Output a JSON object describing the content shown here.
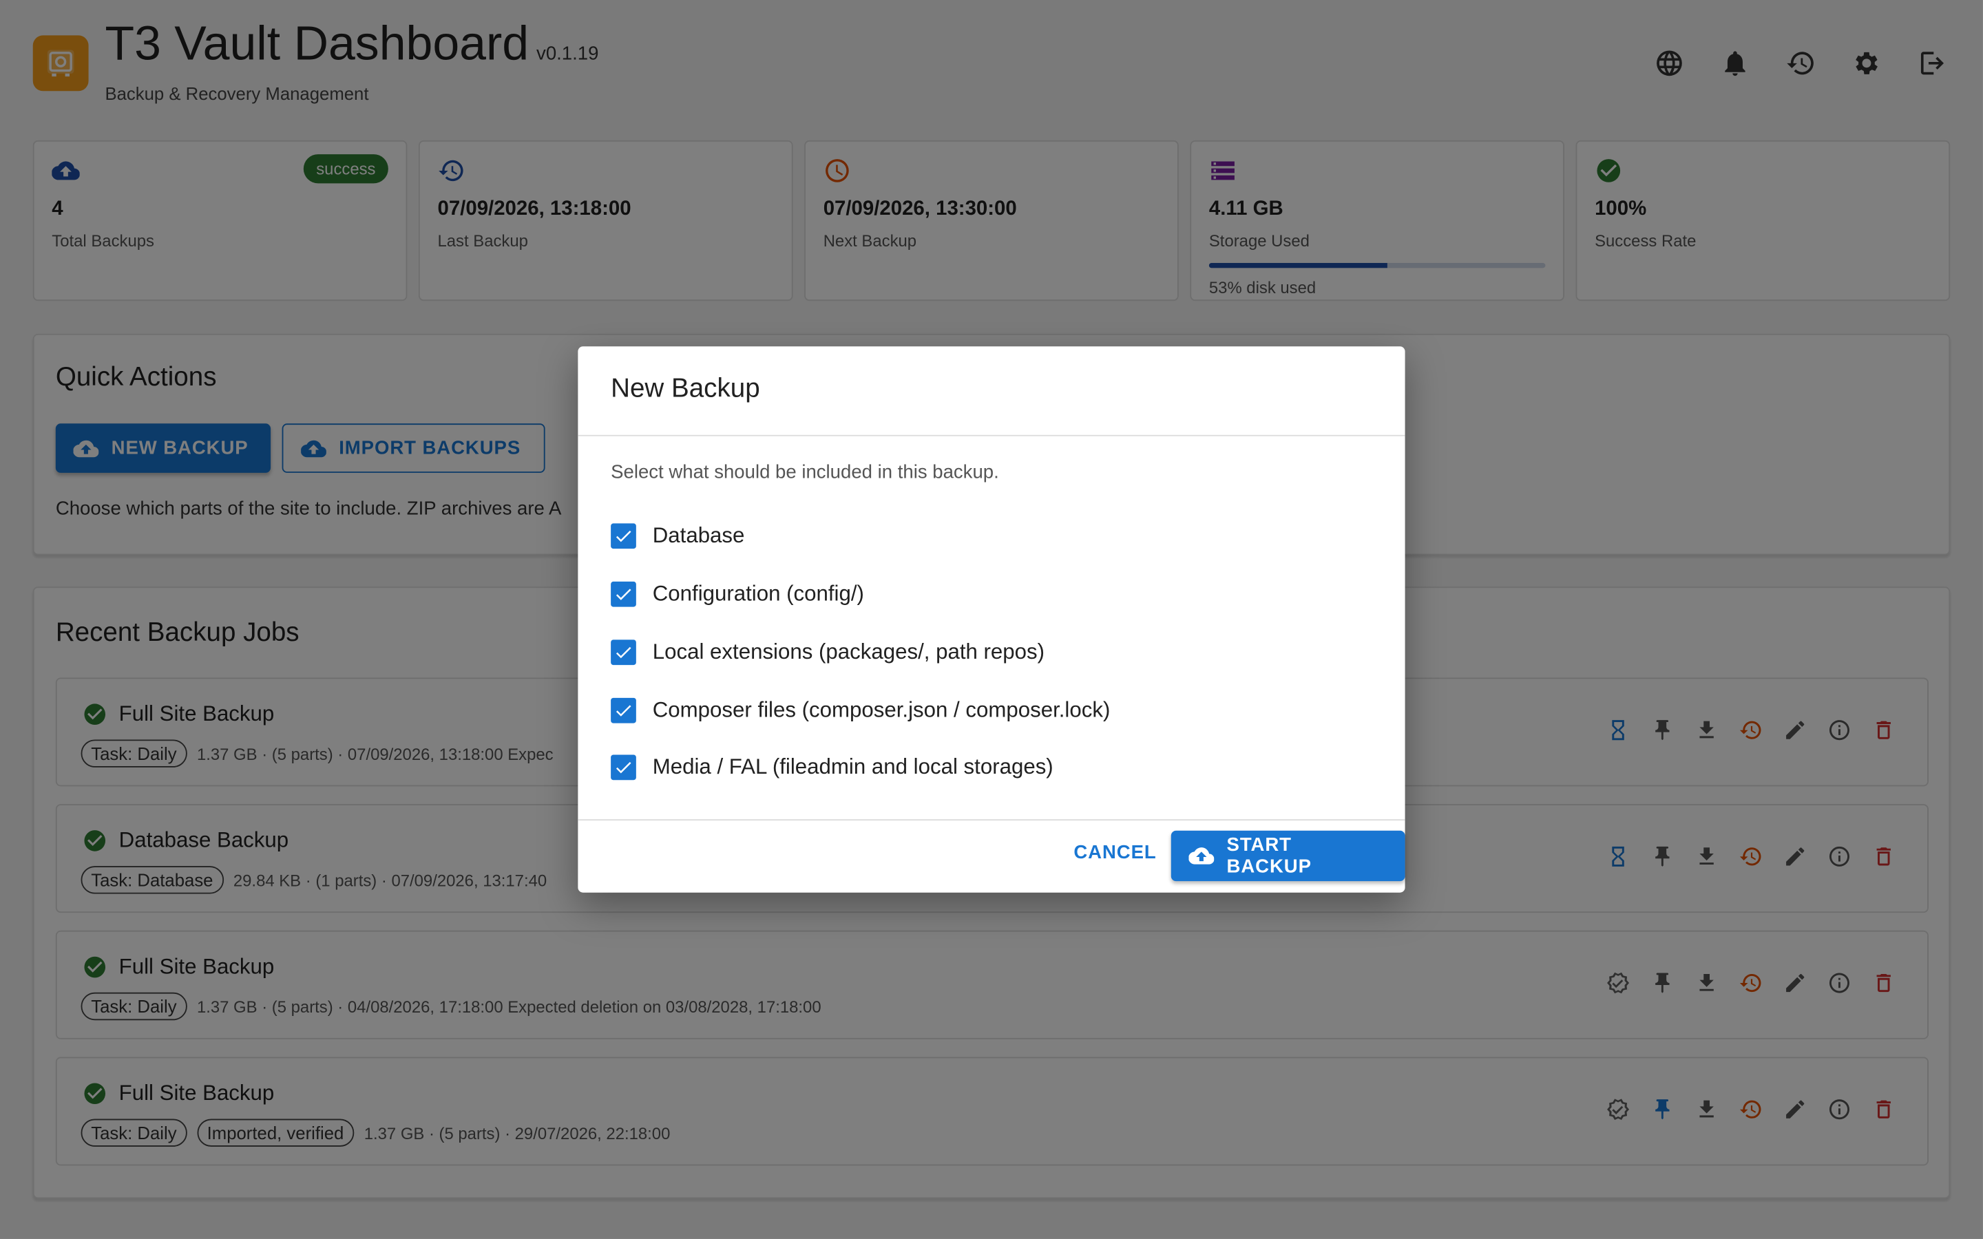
{
  "header": {
    "title": "T3 Vault Dashboard",
    "version": "v0.1.19",
    "subtitle": "Backup & Recovery Management",
    "icons": [
      "globe-icon",
      "bell-icon",
      "history-icon",
      "gear-icon",
      "logout-icon"
    ]
  },
  "stats": [
    {
      "value": "4",
      "label": "Total Backups",
      "badge": "success",
      "icon": "cloud-upload-icon",
      "color": "#1e4fa8"
    },
    {
      "value": "07/09/2026, 13:18:00",
      "label": "Last Backup",
      "icon": "history-icon",
      "color": "#1e4fa8"
    },
    {
      "value": "07/09/2026, 13:30:00",
      "label": "Next Backup",
      "icon": "clock-icon",
      "color": "#e65100"
    },
    {
      "value": "4.11 GB",
      "label": "Storage Used",
      "progress": 53,
      "sub": "53% disk used",
      "icon": "storage-icon",
      "color": "#7b1fa2"
    },
    {
      "value": "100%",
      "label": "Success Rate",
      "icon": "check-circle-icon",
      "color": "#2e7d32"
    }
  ],
  "quick_actions": {
    "title": "Quick Actions",
    "new_backup": "NEW BACKUP",
    "import_backups": "IMPORT BACKUPS",
    "text": "Choose which parts of the site to include. ZIP archives are A"
  },
  "recent_jobs": {
    "title": "Recent Backup Jobs",
    "items": [
      {
        "title": "Full Site Backup",
        "chips": [
          "Task: Daily"
        ],
        "meta": "1.37 GB · (5 parts) · 07/09/2026, 13:18:00   Expec",
        "status_icon": "hourglass-icon",
        "pinned": false
      },
      {
        "title": "Database Backup",
        "chips": [
          "Task: Database"
        ],
        "meta": "29.84 KB · (1 parts) · 07/09/2026, 13:17:40",
        "status_icon": "hourglass-icon",
        "pinned": false
      },
      {
        "title": "Full Site Backup",
        "chips": [
          "Task: Daily"
        ],
        "meta": "1.37 GB · (5 parts) · 04/08/2026, 17:18:00   Expected deletion on 03/08/2028, 17:18:00",
        "status_icon": "verified-icon",
        "pinned": false
      },
      {
        "title": "Full Site Backup",
        "chips": [
          "Task: Daily",
          "Imported, verified"
        ],
        "meta": "1.37 GB · (5 parts) · 29/07/2026, 22:18:00",
        "status_icon": "verified-icon",
        "pinned": true
      }
    ]
  },
  "dialog": {
    "title": "New Backup",
    "description": "Select what should be included in this backup.",
    "options": [
      {
        "label": "Database",
        "checked": true
      },
      {
        "label": "Configuration (config/)",
        "checked": true
      },
      {
        "label": "Local extensions (packages/, path repos)",
        "checked": true
      },
      {
        "label": "Composer files (composer.json / composer.lock)",
        "checked": true
      },
      {
        "label": "Media / FAL (fileadmin and local storages)",
        "checked": true
      }
    ],
    "cancel": "CANCEL",
    "start": "START BACKUP"
  },
  "colors": {
    "primary": "#1976d2",
    "success": "#2e7d32",
    "restore": "#e65100",
    "delete": "#d32f2f",
    "logo": "#f59c1a"
  }
}
